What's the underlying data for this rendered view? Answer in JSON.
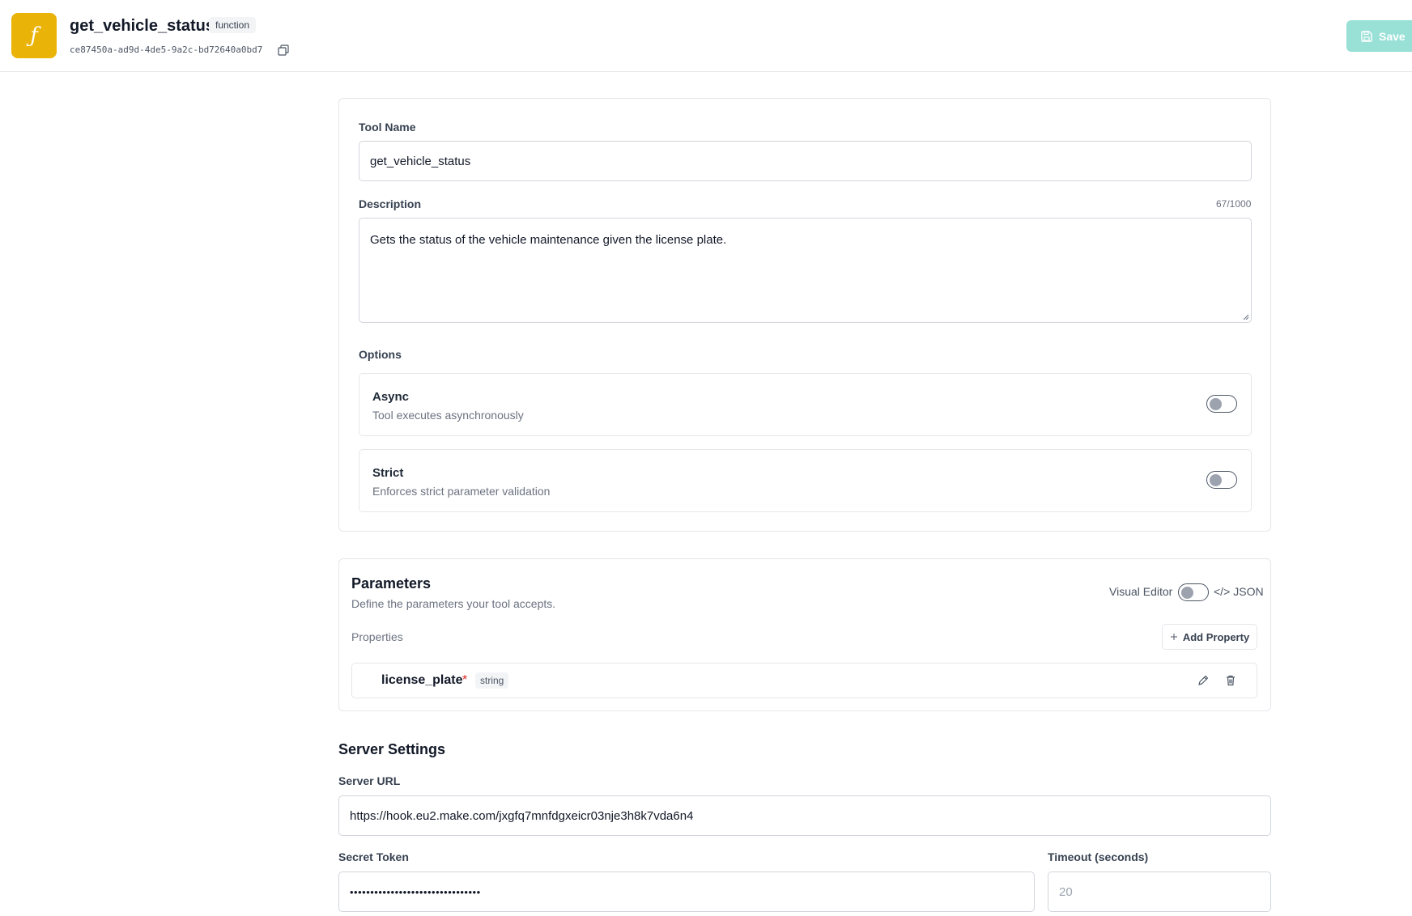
{
  "header": {
    "logo_glyph": "ƒ",
    "title": "get_vehicle_status",
    "type_badge": "function",
    "id": "ce87450a-ad9d-4de5-9a2c-bd72640a0bd7",
    "save_label": "Save"
  },
  "form": {
    "tool_name_label": "Tool Name",
    "tool_name_value": "get_vehicle_status",
    "description_label": "Description",
    "description_counter": "67/1000",
    "description_value": "Gets the status of the vehicle maintenance given the license plate.",
    "options_label": "Options",
    "options": [
      {
        "title": "Async",
        "description": "Tool executes asynchronously",
        "enabled": false
      },
      {
        "title": "Strict",
        "description": "Enforces strict parameter validation",
        "enabled": false
      }
    ]
  },
  "parameters": {
    "title": "Parameters",
    "description": "Define the parameters your tool accepts.",
    "visual_editor_label": "Visual Editor",
    "json_label": "JSON",
    "json_icon": "</>",
    "properties_label": "Properties",
    "add_property_label": "Add Property",
    "properties": [
      {
        "name": "license_plate",
        "required_mark": "*",
        "type": "string"
      }
    ]
  },
  "server": {
    "title": "Server Settings",
    "url_label": "Server URL",
    "url_value": "https://hook.eu2.make.com/jxgfq7mnfdgxeicr03nje3h8k7vda6n4",
    "secret_label": "Secret Token",
    "secret_value": "••••••••••••••••••••••••••••••••",
    "timeout_label": "Timeout (seconds)",
    "timeout_placeholder": "20"
  },
  "colors": {
    "accent": "#eab308",
    "save_button": "#99e0d6",
    "required": "#dc2626"
  }
}
